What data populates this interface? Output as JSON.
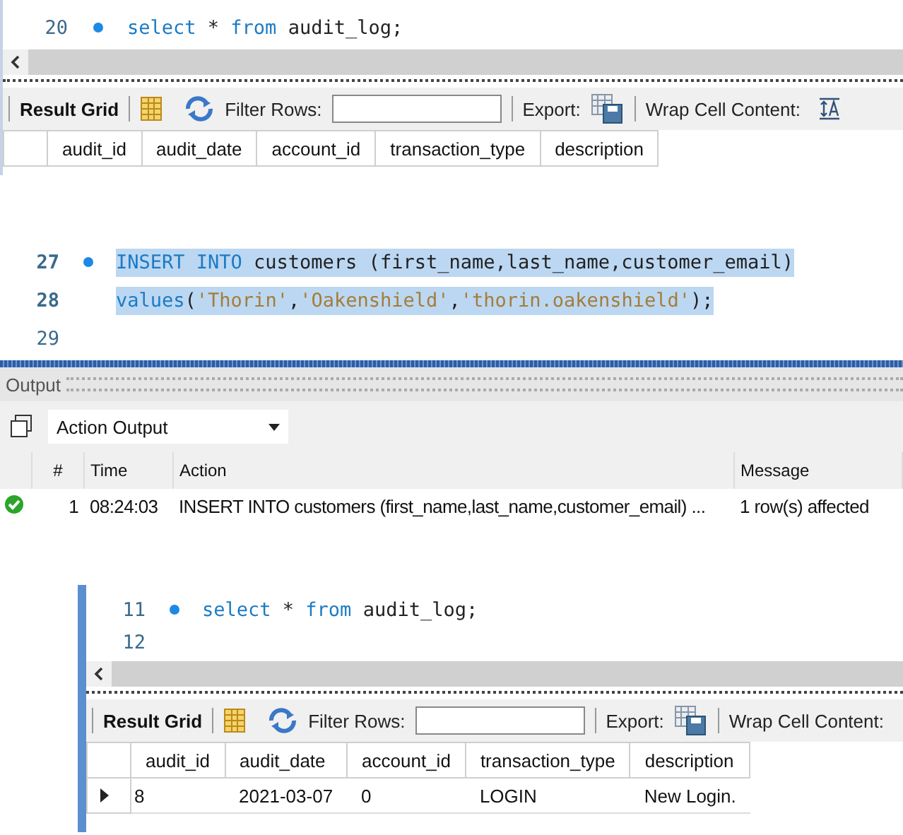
{
  "panels": [
    {
      "kind": "query",
      "editor": {
        "lines": [
          {
            "number": "20",
            "marker": true,
            "selected": false,
            "tokens": [
              {
                "kind": "keyword",
                "text": "select"
              },
              {
                "kind": "plain",
                "text": " * "
              },
              {
                "kind": "keyword",
                "text": "from"
              },
              {
                "kind": "plain",
                "text": " audit_log;"
              }
            ]
          }
        ]
      },
      "toolbar": {
        "result_grid": "Result Grid",
        "filter_label": "Filter Rows:",
        "export_label": "Export:",
        "wrap_label": "Wrap Cell Content:",
        "wrap_icon": true
      },
      "grid": {
        "columns": [
          "audit_id",
          "audit_date",
          "account_id",
          "transaction_type",
          "description"
        ]
      }
    },
    {
      "kind": "output",
      "editor": {
        "lines": [
          {
            "number": "27",
            "marker": true,
            "selected": true,
            "tokens": [
              {
                "kind": "keyword",
                "text": "INSERT INTO"
              },
              {
                "kind": "plain",
                "text": " customers (first_name,last_name,customer_email)"
              }
            ]
          },
          {
            "number": "28",
            "marker": false,
            "selected": true,
            "tokens": [
              {
                "kind": "keyword",
                "text": "values"
              },
              {
                "kind": "plain",
                "text": "("
              },
              {
                "kind": "string",
                "text": "'Thorin'"
              },
              {
                "kind": "plain",
                "text": ","
              },
              {
                "kind": "string",
                "text": "'Oakenshield'"
              },
              {
                "kind": "plain",
                "text": ","
              },
              {
                "kind": "string",
                "text": "'thorin.oakenshield'"
              },
              {
                "kind": "plain",
                "text": ");"
              }
            ]
          },
          {
            "number": "29",
            "marker": false,
            "selected": false
          }
        ]
      },
      "output": {
        "title": "Output",
        "dropdown": "Action Output",
        "columns": [
          "#",
          "Time",
          "Action",
          "Message"
        ],
        "rows": [
          {
            "succeeded": true,
            "cells": [
              "1",
              "08:24:03",
              "INSERT INTO customers (first_name,last_name,customer_email) ...",
              "1 row(s) affected"
            ]
          }
        ]
      }
    },
    {
      "kind": "query",
      "editor": {
        "lines": [
          {
            "number": "11",
            "marker": true,
            "selected": false,
            "tokens": [
              {
                "kind": "keyword",
                "text": "select"
              },
              {
                "kind": "plain",
                "text": " * "
              },
              {
                "kind": "keyword",
                "text": "from"
              },
              {
                "kind": "plain",
                "text": " audit_log;"
              }
            ]
          },
          {
            "number": "12",
            "marker": false,
            "selected": false
          }
        ]
      },
      "toolbar": {
        "result_grid": "Result Grid",
        "filter_label": "Filter Rows:",
        "export_label": "Export:",
        "wrap_label": "Wrap Cell Content:"
      },
      "grid": {
        "columns": [
          "audit_id",
          "audit_date",
          "account_id",
          "transaction_type",
          "description"
        ],
        "rows": [
          {
            "current": true,
            "cells": [
              "8",
              "2021-03-07",
              "0",
              "LOGIN",
              "New Login."
            ]
          }
        ]
      }
    }
  ]
}
